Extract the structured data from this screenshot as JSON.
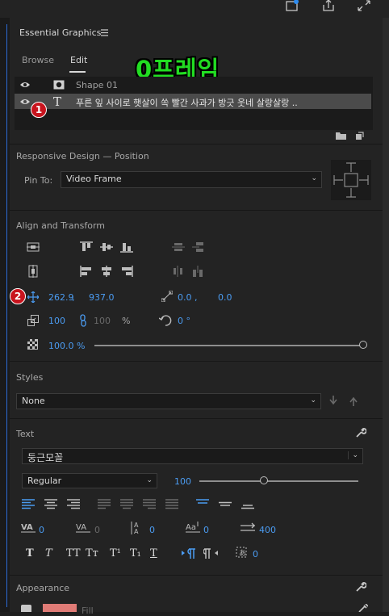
{
  "header": {
    "title": "Essential Graphics",
    "menu_icon": "hamburger-icon"
  },
  "tabs": [
    {
      "label": "Browse",
      "active": false
    },
    {
      "label": "Edit",
      "active": true
    }
  ],
  "overlay_title": "0프레임",
  "layers": [
    {
      "name": "Shape 01",
      "icon": "shape-icon",
      "selected": false
    },
    {
      "name": "푸른 잎 사이로 햇살이 쏙 빨간 사과가 방긋 웃네 살랑살랑 ..",
      "icon": "text-icon",
      "selected": true
    }
  ],
  "badges": [
    "1",
    "2"
  ],
  "responsive": {
    "section": "Responsive Design — Position",
    "pin_label": "Pin To:",
    "pin_value": "Video Frame"
  },
  "align": {
    "section": "Align and Transform",
    "position_x": "262.9",
    "position_y": "937.0",
    "comma": ",",
    "anchor_x": "0.0",
    "anchor_y": "0.0",
    "scale": "100",
    "scale_width": "100",
    "percent": "%",
    "rotation": "0 °",
    "opacity": "100.0 %"
  },
  "styles": {
    "section": "Styles",
    "value": "None"
  },
  "text": {
    "section": "Text",
    "font": "둥근모꼴",
    "style": "Regular",
    "size": "100",
    "size_fraction": 0.4,
    "kerning": "0",
    "tracking": "0",
    "leading": "0",
    "baseline": "0",
    "tab_width": "400",
    "tsume": "0",
    "type_buttons": [
      "T",
      "T",
      "TT",
      "Tт",
      "T¹",
      "T₁",
      "T"
    ]
  },
  "appearance": {
    "section": "Appearance",
    "fill_label": "Fill",
    "fill_color": "#e07b76"
  },
  "colors": {
    "accent": "#4b9cf2",
    "badge": "#c8141e",
    "overlay": "#22dd22"
  }
}
